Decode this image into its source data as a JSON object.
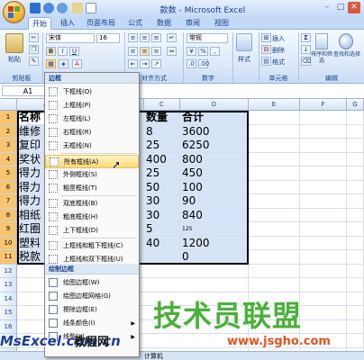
{
  "window": {
    "title": "款数 - Microsoft Excel"
  },
  "tabs": [
    "开始",
    "插入",
    "页面布局",
    "公式",
    "数据",
    "审阅",
    "视图"
  ],
  "ribbon": {
    "paste": "粘贴",
    "clipboard": "剪贴板",
    "font_name": "宋体",
    "font_size": "16",
    "font_group": "字体",
    "alignment_group": "对齐方式",
    "number_format": "常规",
    "number_group": "数字",
    "styles": "样式",
    "insert": "插入",
    "delete": "删除",
    "format": "格式",
    "cells_group": "单元格",
    "sort_filter": "排序和筛选",
    "find_select": "查找和选择",
    "editing_group": "编辑",
    "bold": "B",
    "italic": "I",
    "underline": "U",
    "currency": "%"
  },
  "formula": {
    "name_box": "A1",
    "content": "称"
  },
  "columns": [
    "A",
    "B",
    "C",
    "D",
    "E",
    "F",
    "G"
  ],
  "rows": [
    "1",
    "2",
    "3",
    "4",
    "5",
    "6",
    "7",
    "8",
    "9",
    "10",
    "11",
    "12",
    "13",
    "14",
    "15",
    "16",
    "17",
    "18"
  ],
  "sheet": {
    "a": [
      "名称",
      "维修",
      "复印",
      "奖状",
      "得力",
      "得力",
      "得力",
      "相纸",
      "红圈",
      "塑料",
      "税款"
    ],
    "c": [
      "数量",
      "8",
      "25",
      "400",
      "25",
      "50",
      "30",
      "30",
      "5",
      "40",
      ""
    ],
    "d": [
      "合计",
      "3600",
      "6250",
      "800",
      "450",
      "100",
      "90",
      "840",
      "125",
      "1200",
      "0"
    ]
  },
  "menu": {
    "header1": "边框",
    "items": [
      {
        "label": "下框线(O)"
      },
      {
        "label": "上框线(P)"
      },
      {
        "label": "左框线(L)"
      },
      {
        "label": "右框线(R)"
      },
      {
        "label": "无框线(N)"
      },
      {
        "label": "所有框线(A)"
      },
      {
        "label": "外侧框线(S)"
      },
      {
        "label": "粗匣框线(T)"
      },
      {
        "label": "双底框线(B)"
      },
      {
        "label": "粗底框线(H)"
      },
      {
        "label": "上下框线(D)"
      },
      {
        "label": "上框线和粗下框线(C)"
      },
      {
        "label": "上框线和双下框线(U)"
      }
    ],
    "header2": "绘制边框",
    "draw_items": [
      {
        "label": "绘图边框(W)"
      },
      {
        "label": "绘图边框网格(G)"
      },
      {
        "label": "擦除边框(E)"
      },
      {
        "label": "线条颜色(I)",
        "arrow": "▶"
      },
      {
        "label": "线型(Y)",
        "arrow": "▶"
      }
    ]
  },
  "watermark": {
    "main": "技术员联盟",
    "url": "www.jsgho.com",
    "left": "MsExcel.com.cn",
    "left2": "教程网"
  },
  "sheet_tab": "计算机"
}
